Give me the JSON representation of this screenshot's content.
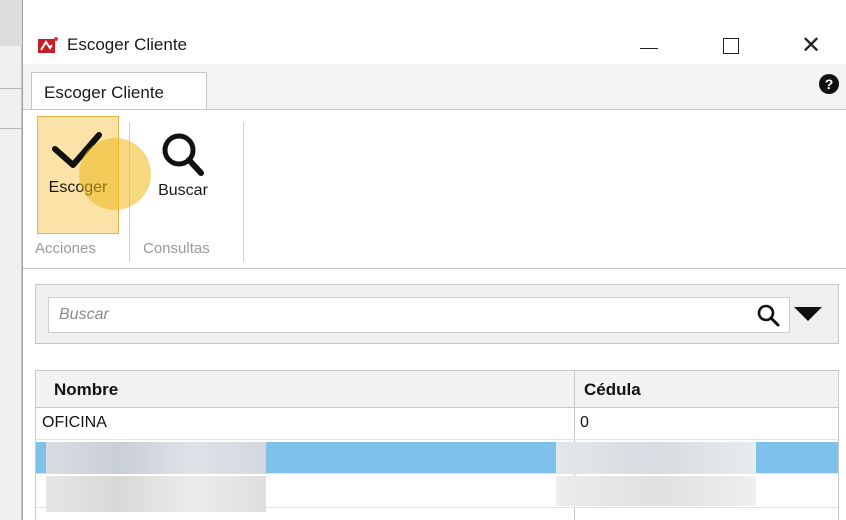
{
  "window": {
    "title": "Escoger Cliente",
    "controls": {
      "minimize": "—",
      "maximize": "☐",
      "close": "✕"
    }
  },
  "ribbon": {
    "tab_label": "Escoger Cliente",
    "help_label": "?",
    "buttons": {
      "escoger": "Escoger",
      "buscar": "Buscar"
    },
    "groups": {
      "acciones": "Acciones",
      "consultas": "Consultas"
    }
  },
  "search": {
    "placeholder": "Buscar",
    "value": ""
  },
  "table": {
    "columns": [
      "Nombre",
      "Cédula"
    ],
    "rows": [
      {
        "nombre": "OFICINA",
        "cedula": "0"
      }
    ]
  },
  "colors": {
    "selected_button_bg": "#fbe2a6",
    "selected_row": "#7ec1ea",
    "click_indicator": "#ecb818"
  },
  "icons": {
    "app": "pdf-app-icon",
    "escoger": "checkmark-icon",
    "buscar": "magnifier-icon",
    "search": "search-icon",
    "dropdown": "dropdown-arrow-icon",
    "help": "help-icon"
  }
}
